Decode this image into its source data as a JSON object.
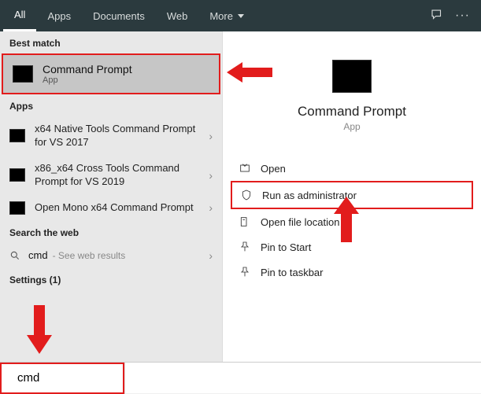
{
  "topbar": {
    "tabs": [
      "All",
      "Apps",
      "Documents",
      "Web",
      "More"
    ]
  },
  "left": {
    "best_label": "Best match",
    "best_title": "Command Prompt",
    "best_sub": "App",
    "apps_label": "Apps",
    "apps": [
      "x64 Native Tools Command Prompt for VS 2017",
      "x86_x64 Cross Tools Command Prompt for VS 2019",
      "Open Mono x64 Command Prompt"
    ],
    "web_label": "Search the web",
    "web_query": "cmd",
    "web_hint": "- See web results",
    "settings_label": "Settings (1)"
  },
  "right": {
    "title": "Command Prompt",
    "sub": "App",
    "actions": {
      "open": "Open",
      "admin": "Run as administrator",
      "loc": "Open file location",
      "pin_start": "Pin to Start",
      "pin_taskbar": "Pin to taskbar"
    }
  },
  "search": {
    "value": "cmd"
  }
}
